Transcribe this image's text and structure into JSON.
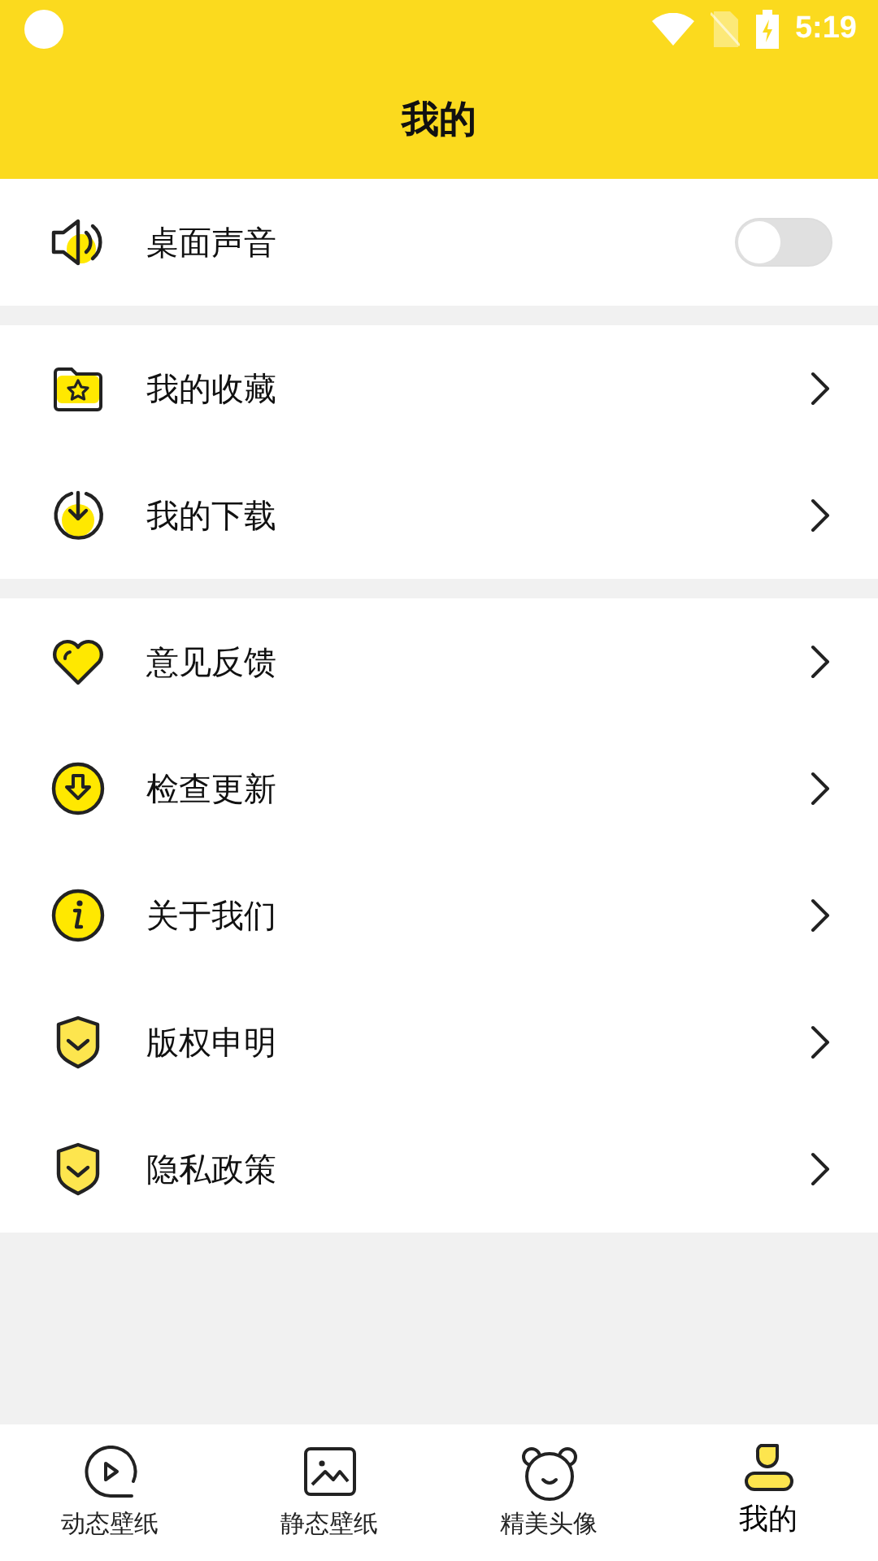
{
  "status_bar": {
    "time": "5:19"
  },
  "header": {
    "title": "我的"
  },
  "groups": [
    {
      "items": [
        {
          "label": "桌面声音",
          "kind": "toggle",
          "on": false
        }
      ]
    },
    {
      "items": [
        {
          "label": "我的收藏",
          "kind": "link"
        },
        {
          "label": "我的下载",
          "kind": "link"
        }
      ]
    },
    {
      "items": [
        {
          "label": "意见反馈",
          "kind": "link"
        },
        {
          "label": "检查更新",
          "kind": "link"
        },
        {
          "label": "关于我们",
          "kind": "link"
        },
        {
          "label": "版权申明",
          "kind": "link"
        },
        {
          "label": "隐私政策",
          "kind": "link"
        }
      ]
    }
  ],
  "tabs": [
    {
      "label": "动态壁纸",
      "selected": false
    },
    {
      "label": "静态壁纸",
      "selected": false
    },
    {
      "label": "精美头像",
      "selected": false
    },
    {
      "label": "我的",
      "selected": true
    }
  ]
}
